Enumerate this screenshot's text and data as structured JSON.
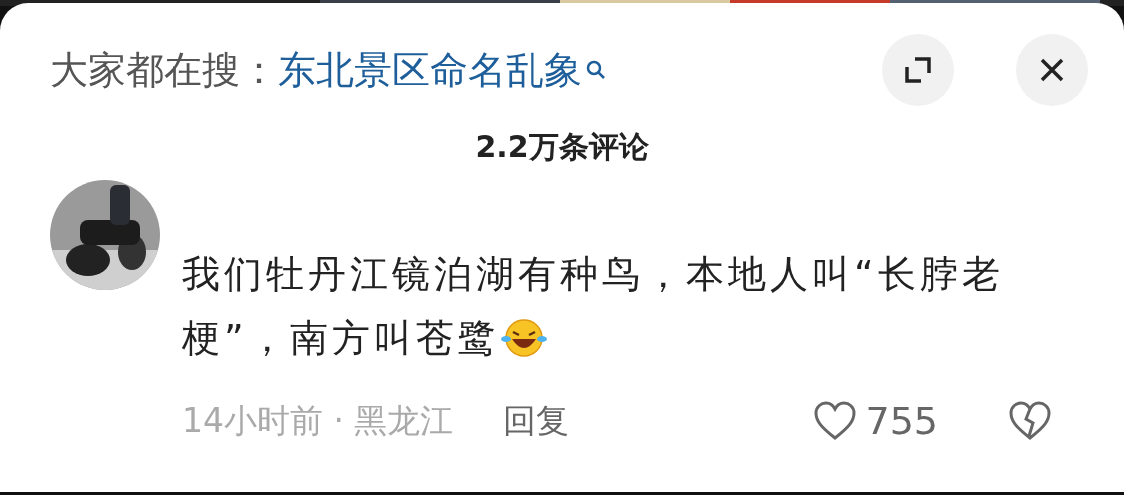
{
  "header": {
    "prefix": "大家都在搜：",
    "search_link": "东北景区命名乱象"
  },
  "comments_title": "2.2万条评论",
  "comments": [
    {
      "text": "我们牡丹江镜泊湖有种鸟，本地人叫“长脖老梗”，南方叫苍鹭",
      "meta": "14小时前 · 黑龙江",
      "reply": "回复",
      "likes": "755"
    }
  ]
}
